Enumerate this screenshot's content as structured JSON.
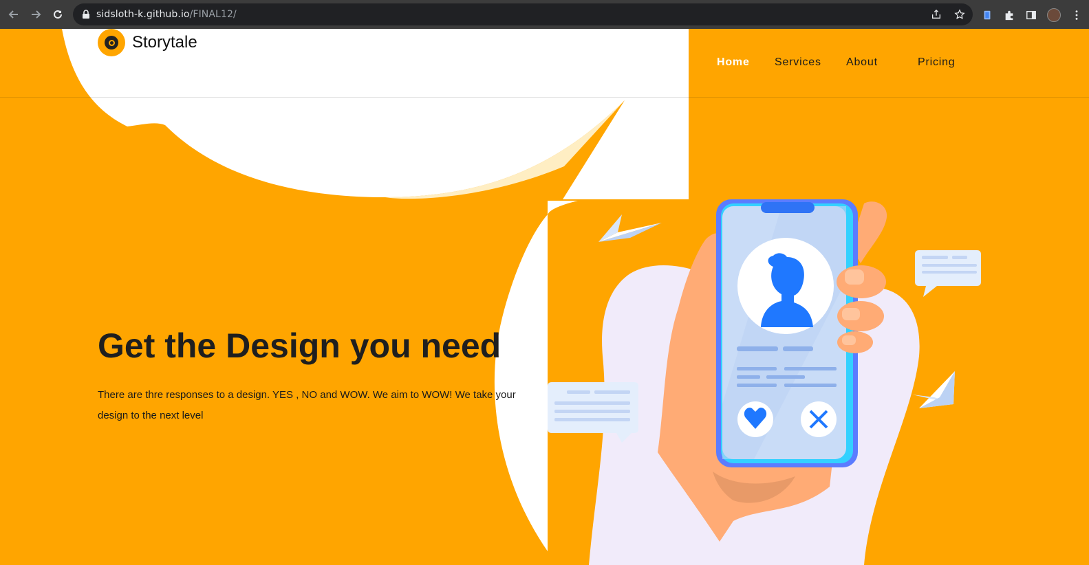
{
  "browser": {
    "url_host": "sidsloth-k.github.io",
    "url_path": "/FINAL12/"
  },
  "site": {
    "brand": "Storytale",
    "nav": [
      {
        "label": "Home",
        "active": true
      },
      {
        "label": "Services",
        "active": false
      },
      {
        "label": "About",
        "active": false
      },
      {
        "label": "Pricing",
        "active": false
      }
    ]
  },
  "hero": {
    "title": "Get the Design you need",
    "text": "There are thre responses to a design. YES , NO and WOW. We aim to WOW! We take your design to the next level"
  },
  "colors": {
    "accent": "#FFA500",
    "nav_active": "#FFFFFF",
    "text": "#1F1F1F"
  }
}
